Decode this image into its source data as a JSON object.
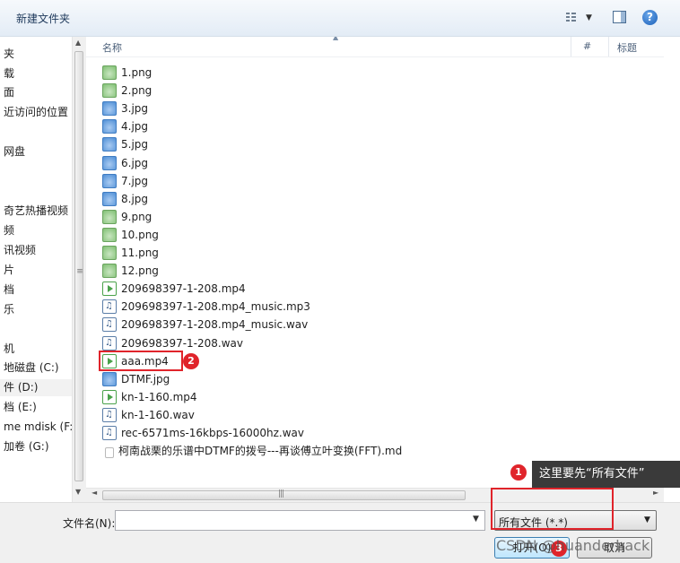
{
  "toolbar": {
    "new_folder": "新建文件夹",
    "help": "?"
  },
  "nav": {
    "items": [
      "夹",
      "载",
      "面",
      "近访问的位置",
      "网盘",
      "奇艺热播视频",
      "频",
      "讯视频",
      "片",
      "档",
      "乐",
      "机",
      "地磁盘 (C:)",
      "件 (D:)",
      "档 (E:)",
      "me mdisk (F:",
      "加卷 (G:)"
    ],
    "selected_index": 13
  },
  "columns": {
    "name": "名称",
    "number": "#",
    "title": "标题"
  },
  "files": [
    {
      "name": "1.png",
      "icon": "png-image-icon"
    },
    {
      "name": "2.png",
      "icon": "png-image-icon"
    },
    {
      "name": "3.jpg",
      "icon": "jpg-image-icon"
    },
    {
      "name": "4.jpg",
      "icon": "jpg-image-icon"
    },
    {
      "name": "5.jpg",
      "icon": "jpg-image-icon"
    },
    {
      "name": "6.jpg",
      "icon": "jpg-image-icon"
    },
    {
      "name": "7.jpg",
      "icon": "jpg-image-icon"
    },
    {
      "name": "8.jpg",
      "icon": "jpg-image-icon"
    },
    {
      "name": "9.png",
      "icon": "png-image-icon"
    },
    {
      "name": "10.png",
      "icon": "png-image-icon"
    },
    {
      "name": "11.png",
      "icon": "png-image-icon"
    },
    {
      "name": "12.png",
      "icon": "png-image-icon"
    },
    {
      "name": "209698397-1-208.mp4",
      "icon": "video-file-icon"
    },
    {
      "name": "209698397-1-208.mp4_music.mp3",
      "icon": "audio-file-icon"
    },
    {
      "name": "209698397-1-208.mp4_music.wav",
      "icon": "audio-file-icon"
    },
    {
      "name": "209698397-1-208.wav",
      "icon": "audio-file-icon"
    },
    {
      "name": "aaa.mp4",
      "icon": "video-file-icon"
    },
    {
      "name": "DTMF.jpg",
      "icon": "jpg-image-icon"
    },
    {
      "name": "kn-1-160.mp4",
      "icon": "video-file-icon"
    },
    {
      "name": "kn-1-160.wav",
      "icon": "audio-file-icon"
    },
    {
      "name": "rec-6571ms-16kbps-16000hz.wav",
      "icon": "audio-file-icon"
    },
    {
      "name": "柯南战栗的乐谱中DTMF的拨号---再谈傅立叶变换(FFT).md",
      "icon": "text-file-icon"
    }
  ],
  "bottom": {
    "filename_label": "文件名(N):",
    "filename_value": "",
    "filetype_value": "所有文件 (*.*)",
    "open_label": "打开(O)",
    "cancel_label": "取消"
  },
  "annotations": {
    "badge1": "1",
    "badge2": "2",
    "badge3": "3",
    "tooltip": "这里要先“所有文件”"
  },
  "watermark": "CSDN @huanderhack",
  "colors": {
    "annotation_red": "#e0242b",
    "toolbar_text": "#1e395b"
  }
}
